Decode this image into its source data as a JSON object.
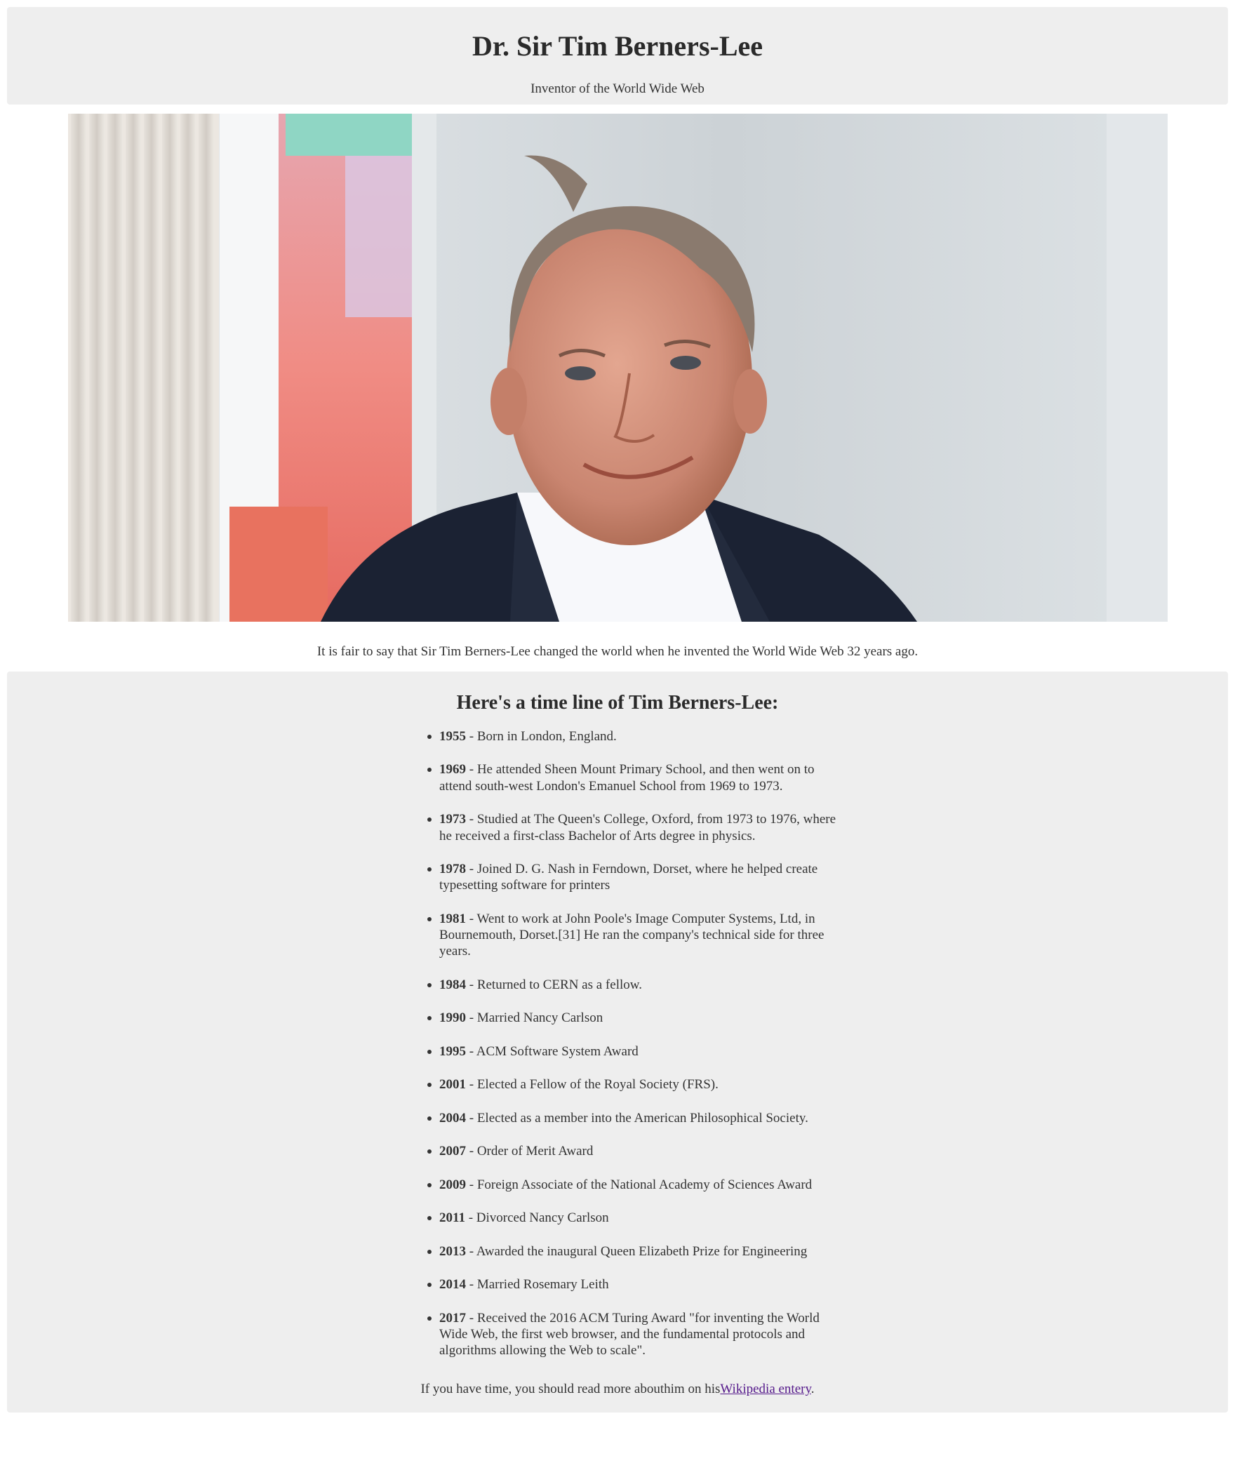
{
  "header": {
    "title": "Dr. Sir Tim Berners-Lee",
    "subtitle": "Inventor of the World Wide Web"
  },
  "intro": "It is fair to say that Sir Tim Berners-Lee changed the world when he invented the World Wide Web 32 years ago.",
  "timeline": {
    "heading": "Here's a time line of Tim Berners-Lee:",
    "items": [
      {
        "year": "1955",
        "text": " - Born in London, England."
      },
      {
        "year": "1969",
        "text": " - He attended Sheen Mount Primary School, and then went on to attend south-west London's Emanuel School from 1969 to 1973."
      },
      {
        "year": "1973",
        "text": " - Studied at The Queen's College, Oxford, from 1973 to 1976, where he received a first-class Bachelor of Arts degree in physics."
      },
      {
        "year": "1978",
        "text": " - Joined D. G. Nash in Ferndown, Dorset, where he helped create typesetting software for printers"
      },
      {
        "year": "1981",
        "text": " - Went to work at John Poole's Image Computer Systems, Ltd, in Bournemouth, Dorset.[31] He ran the company's technical side for three years."
      },
      {
        "year": "1984",
        "text": " - Returned to CERN as a fellow."
      },
      {
        "year": "1990",
        "text": " - Married Nancy Carlson"
      },
      {
        "year": "1995",
        "text": " - ACM Software System Award"
      },
      {
        "year": "2001",
        "text": " - Elected a Fellow of the Royal Society (FRS)."
      },
      {
        "year": "2004",
        "text": " - Elected as a member into the American Philosophical Society."
      },
      {
        "year": "2007",
        "text": " - Order of Merit Award"
      },
      {
        "year": "2009",
        "text": " - Foreign Associate of the National Academy of Sciences Award"
      },
      {
        "year": "2011",
        "text": " - Divorced Nancy Carlson"
      },
      {
        "year": "2013",
        "text": " - Awarded the inaugural Queen Elizabeth Prize for Engineering"
      },
      {
        "year": "2014",
        "text": " - Married Rosemary Leith"
      },
      {
        "year": "2017",
        "text": " - Received the 2016 ACM Turing Award \"for inventing the World Wide Web, the first web browser, and the fundamental protocols and algorithms allowing the Web to scale\"."
      }
    ]
  },
  "footer": {
    "prefix": "If you have time, you should read more abouthim on his",
    "link_label": "Wikipedia entery",
    "suffix": "."
  }
}
